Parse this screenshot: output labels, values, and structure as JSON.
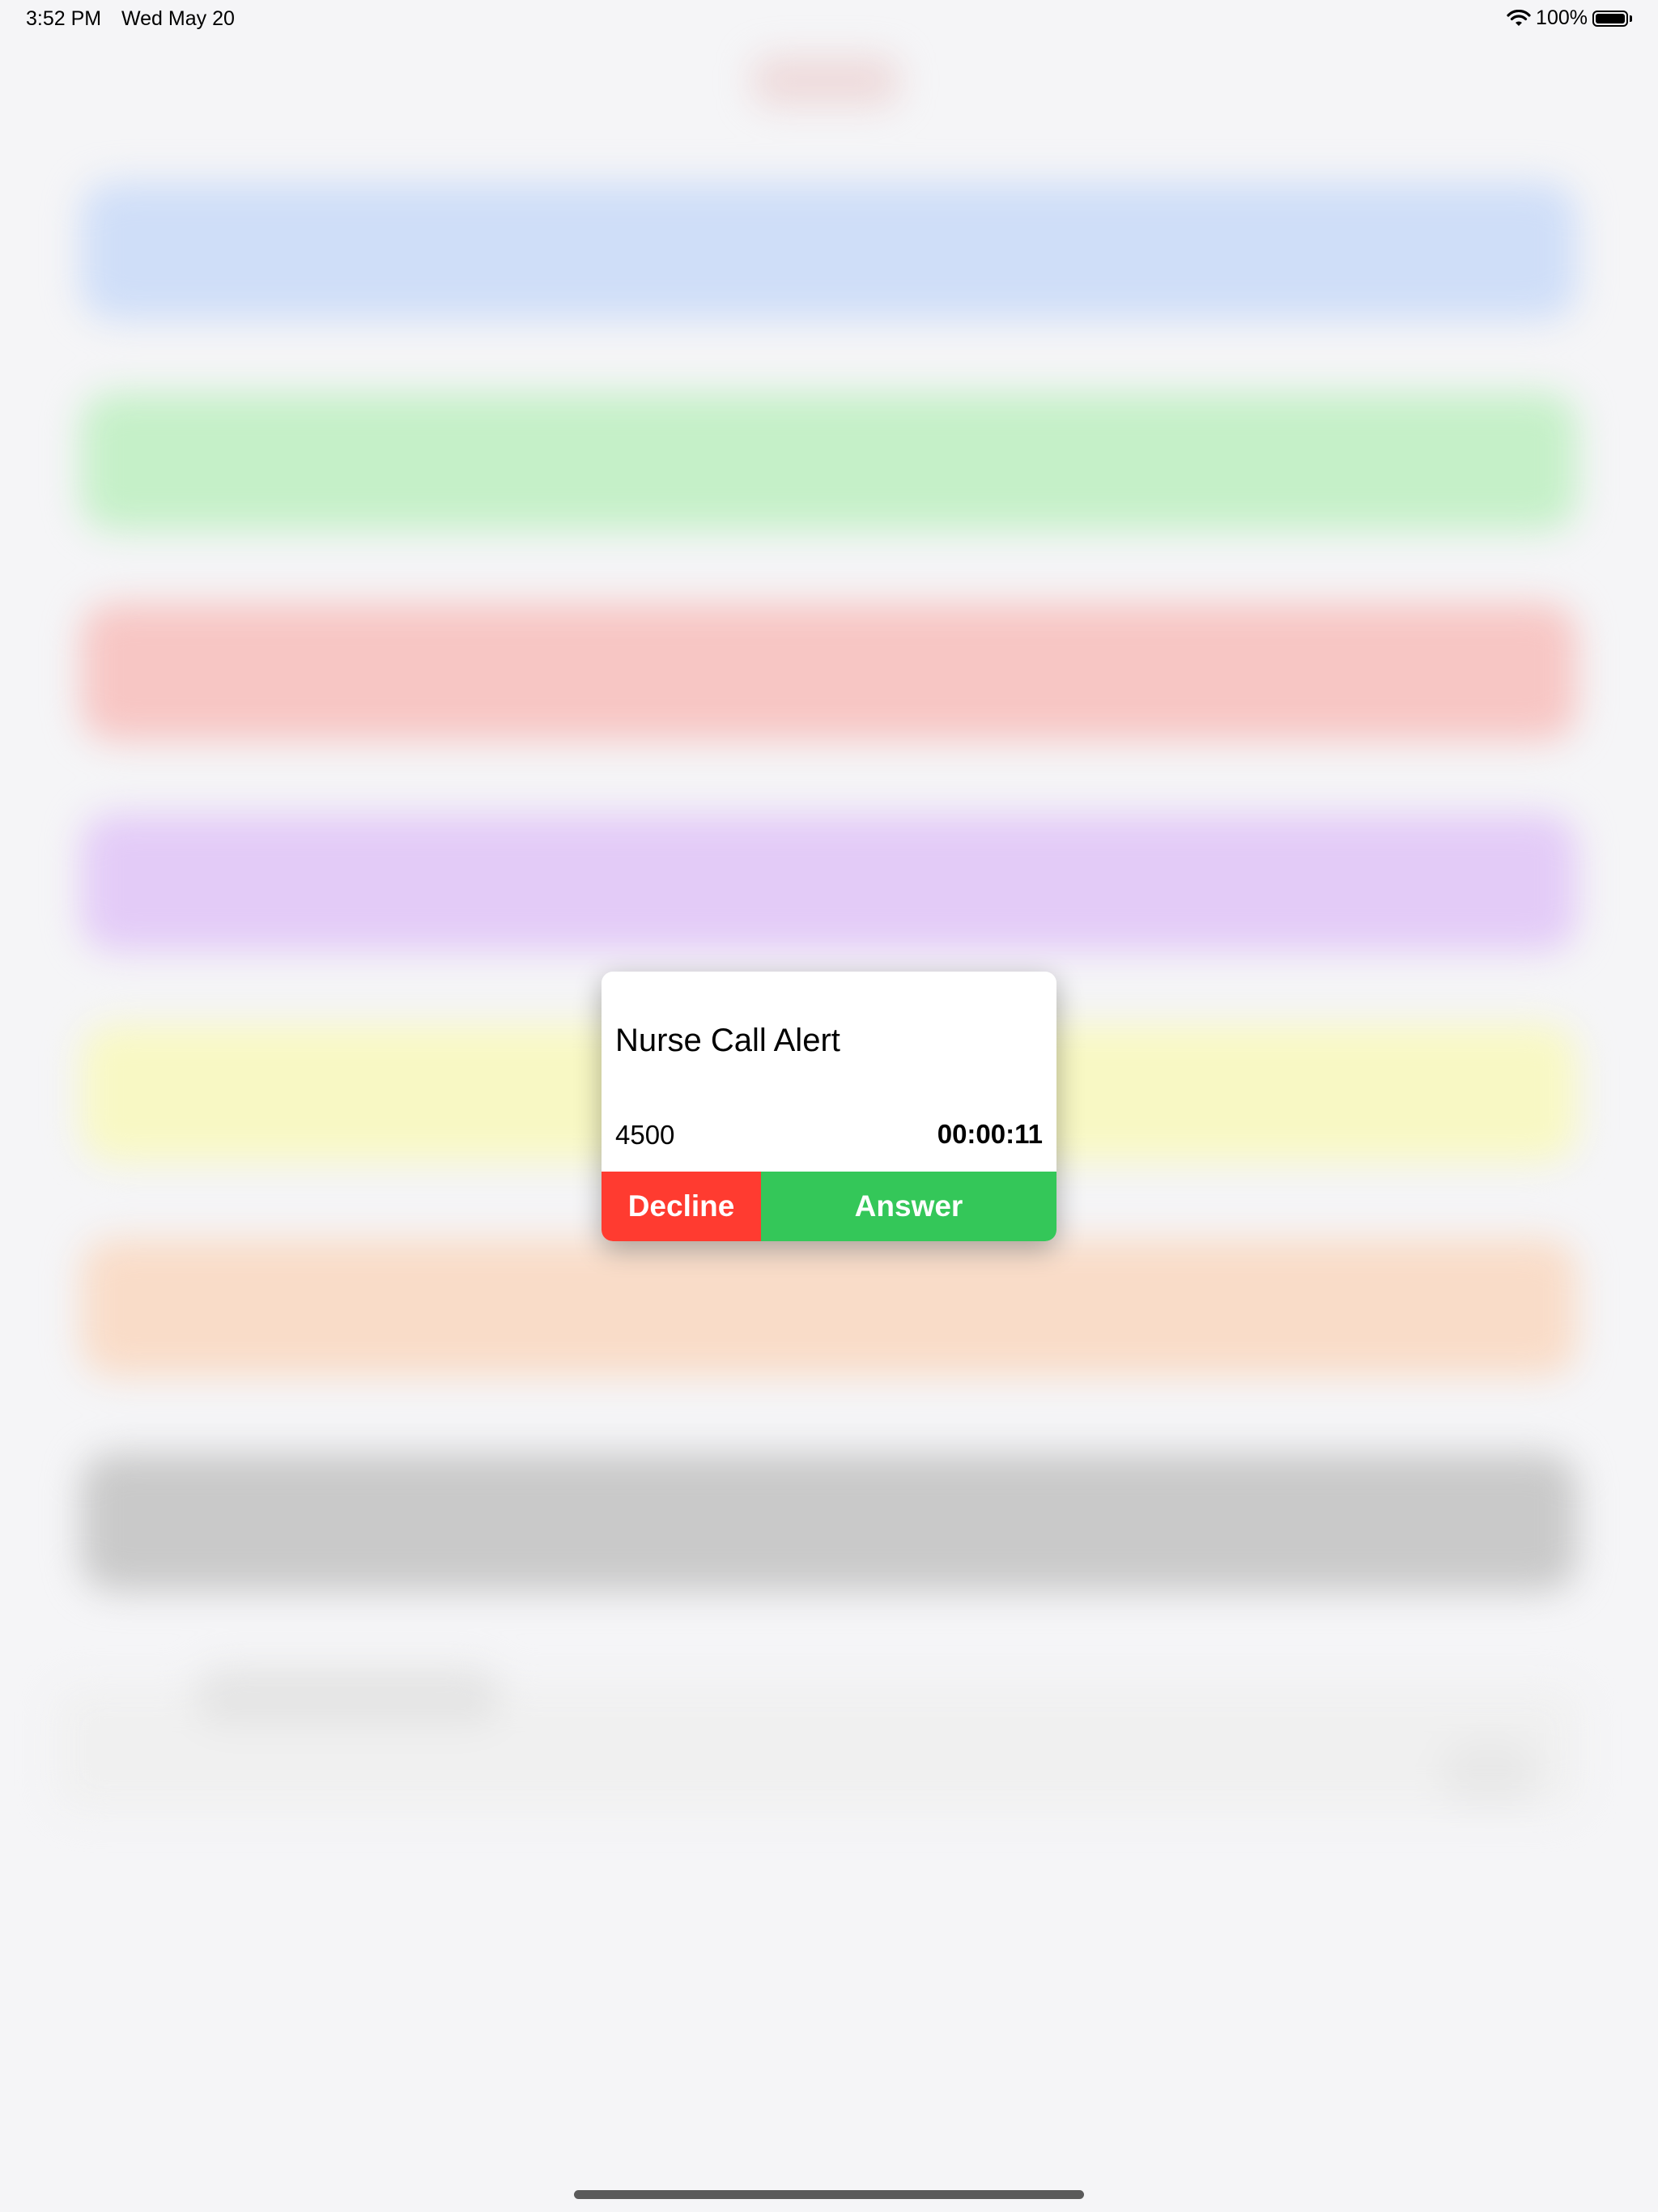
{
  "status_bar": {
    "time": "3:52 PM",
    "date": "Wed May 20",
    "battery": "100%",
    "wifi_icon": "wifi-icon",
    "battery_icon": "battery-full-icon"
  },
  "background_tiles": [
    {
      "color": "#cfdef8"
    },
    {
      "color": "#c5f0c8"
    },
    {
      "color": "#f7c6c4"
    },
    {
      "color": "#e3cbf7"
    },
    {
      "color": "#f8f8c4"
    },
    {
      "color": "#f9dcc8"
    },
    {
      "color": "#c9c9c9"
    }
  ],
  "dialog": {
    "title": "Nurse Call Alert",
    "extension": "4500",
    "timer": "00:00:11",
    "decline_label": "Decline",
    "answer_label": "Answer",
    "decline_color": "#ff3b30",
    "answer_color": "#34c759"
  }
}
